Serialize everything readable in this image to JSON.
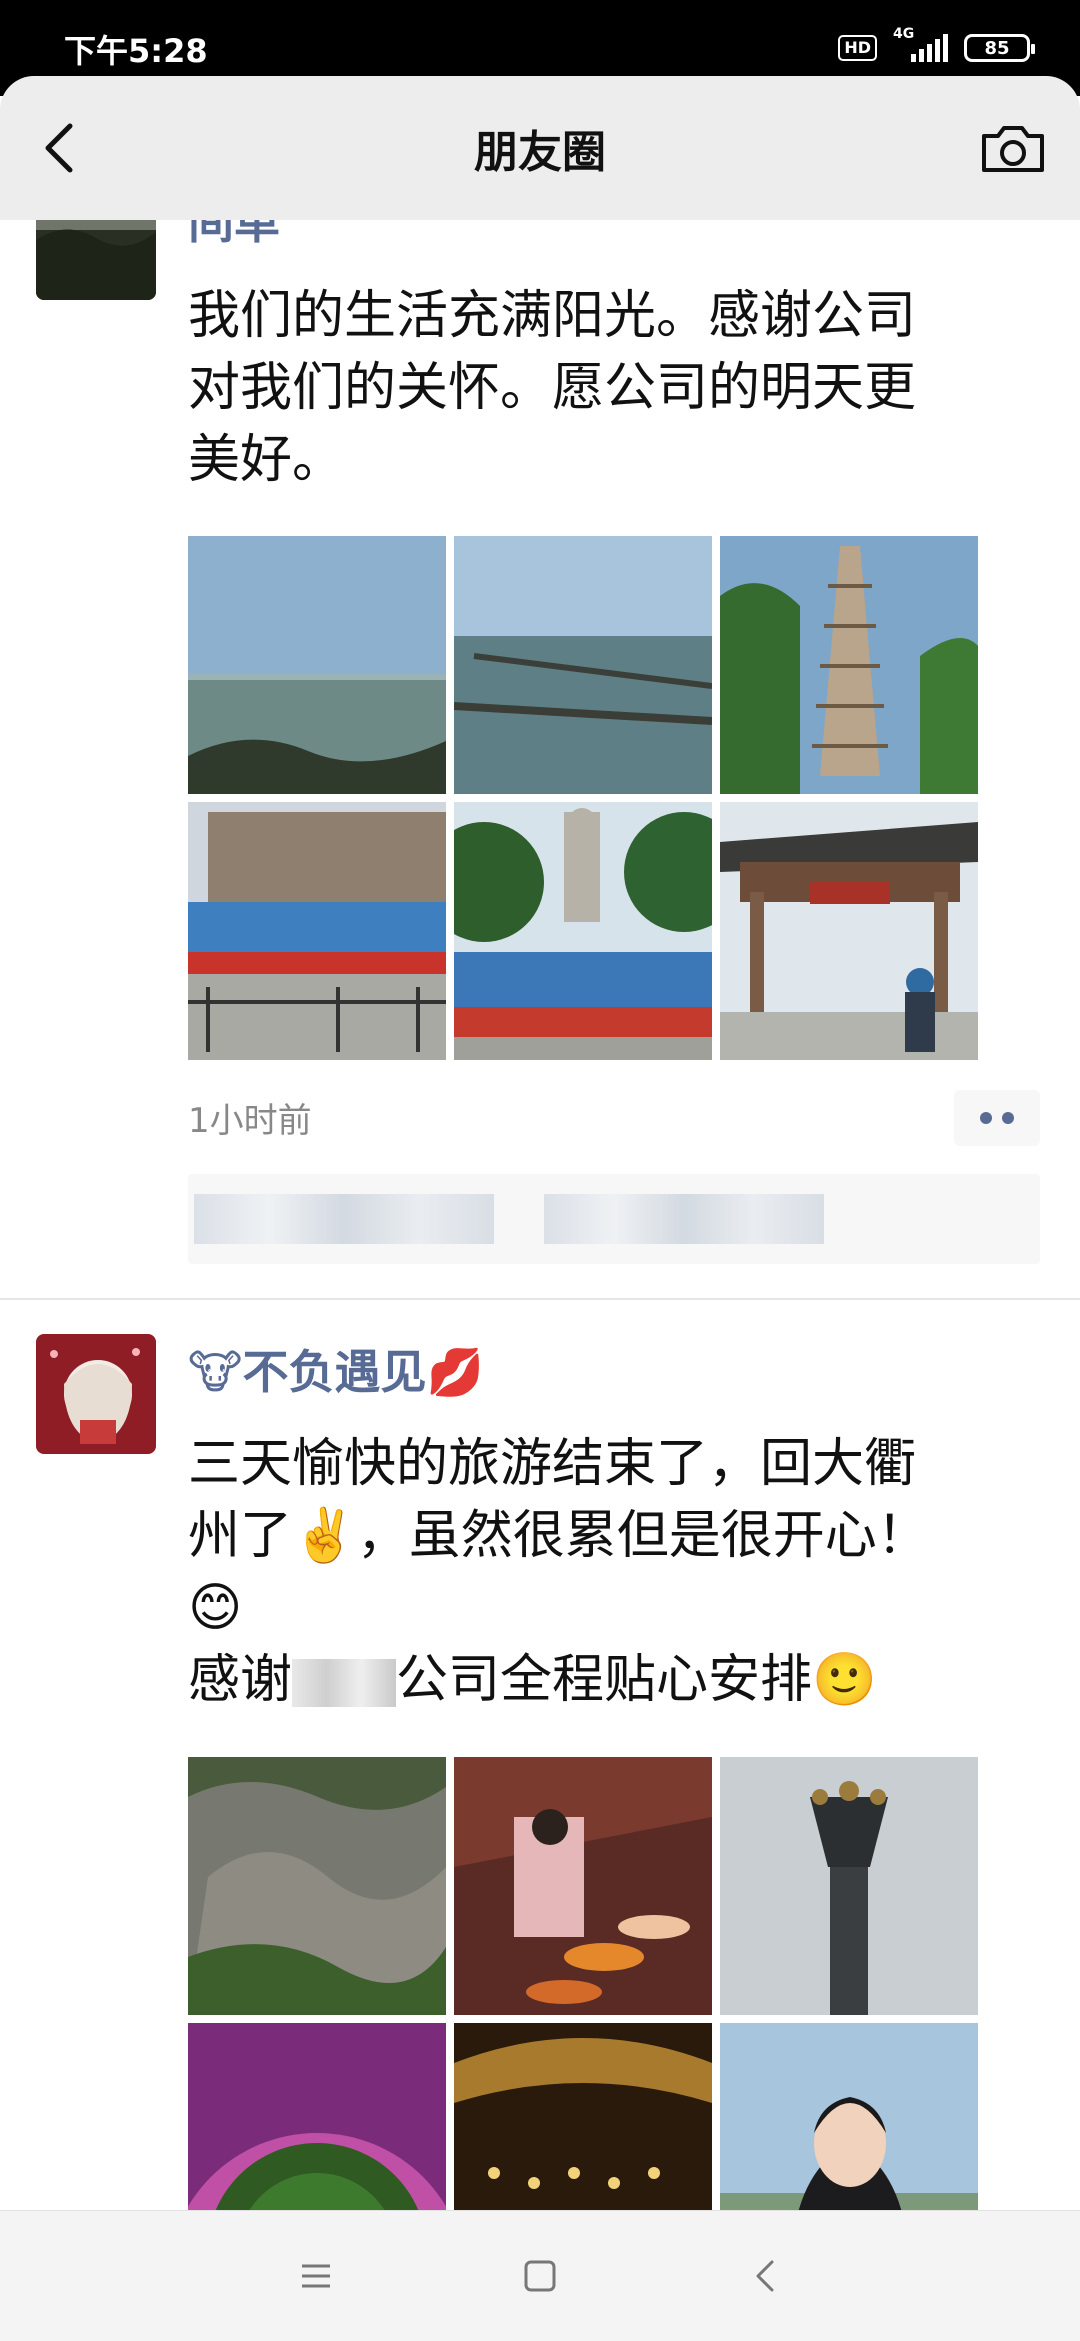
{
  "status_bar": {
    "time": "下午5:28",
    "hd": "HD",
    "network": "4G",
    "battery": "85"
  },
  "header": {
    "title": "朋友圈",
    "back_icon": "chevron-left-icon",
    "camera_icon": "camera-icon"
  },
  "posts": [
    {
      "nickname": "间单",
      "text_lines": [
        "我们的生活充满阳光。感谢公司",
        "对我们的关怀。愿公司的明天更",
        "美好。"
      ],
      "photos": [
        "lake-shore-photo",
        "lake-breakwater-photo",
        "pagoda-photo",
        "group-photo-building",
        "group-photo-buddha-statue",
        "temple-gate-photo"
      ],
      "time": "1小时前"
    },
    {
      "nickname": "不负遇见",
      "nickname_prefix_emoji": "🐮",
      "nickname_suffix_emoji": "💋",
      "text_line1": "三天愉快的旅游结束了，回大衢",
      "text_line2_a": "州了",
      "text_line2_emoji": "✌️",
      "text_line2_b": "，虽然很累但是很开心！",
      "text_line3_emoji": "😊",
      "text_line4_a": "感谢",
      "text_line4_b": "公司全程贴心安排",
      "text_line4_emoji": "🙂",
      "photos": [
        "rockery-garden-photo",
        "koi-pond-photo",
        "bronze-statue-photo",
        "purple-dome-photo",
        "golden-hall-photo",
        "selfie-photo"
      ]
    }
  ],
  "nav": {
    "menu_icon": "menu-icon",
    "home_icon": "home-square-icon",
    "back_icon": "back-triangle-icon"
  }
}
